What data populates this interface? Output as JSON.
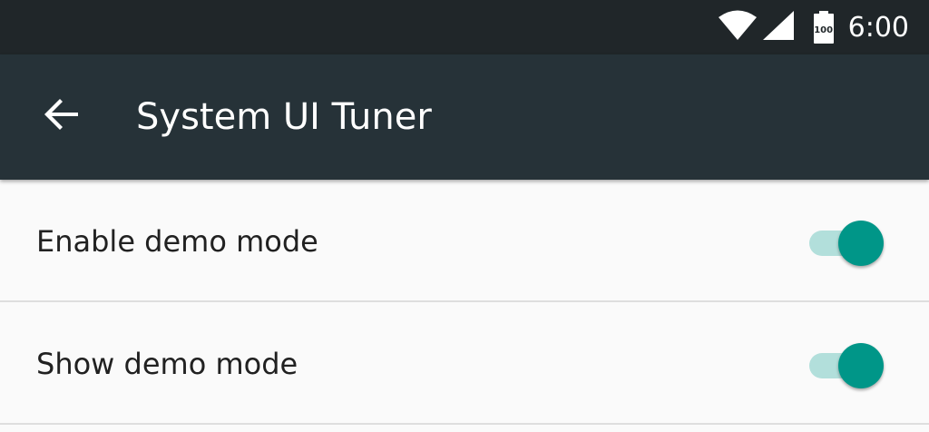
{
  "status_bar": {
    "time": "6:00",
    "battery_level_text": "100",
    "icons": [
      "wifi-icon",
      "cell-signal-icon",
      "battery-icon"
    ]
  },
  "app_bar": {
    "title": "System UI Tuner",
    "back_icon": "back-arrow-icon"
  },
  "settings": [
    {
      "label": "Enable demo mode",
      "checked": true
    },
    {
      "label": "Show demo mode",
      "checked": true
    }
  ],
  "colors": {
    "status_bar": "#202629",
    "app_bar": "#263238",
    "accent": "#009688",
    "accent_track": "#b2dfdb",
    "background": "#fafafa"
  }
}
